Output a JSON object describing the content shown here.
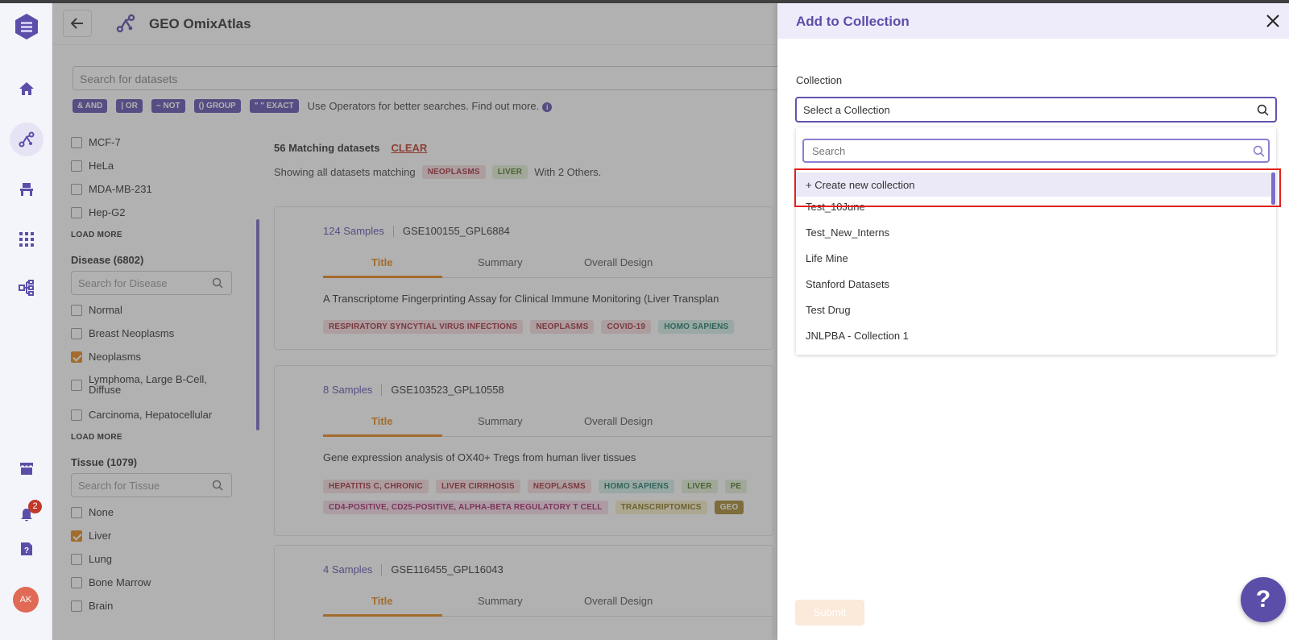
{
  "app": {
    "title": "GEO OmixAtlas",
    "notification_count": "2",
    "avatar_initials": "AK"
  },
  "search": {
    "placeholder": "Search for datasets",
    "operators": [
      "& AND",
      "| OR",
      "~ NOT",
      "() GROUP",
      "\" \" EXACT"
    ],
    "hint": "Use Operators for better searches. Find out more."
  },
  "filters": {
    "cell_lines": [
      {
        "label": "MCF-7",
        "checked": false
      },
      {
        "label": "HeLa",
        "checked": false
      },
      {
        "label": "MDA-MB-231",
        "checked": false
      },
      {
        "label": "Hep-G2",
        "checked": false
      }
    ],
    "load_more": "LOAD MORE",
    "disease": {
      "heading": "Disease (6802)",
      "search_placeholder": "Search for Disease",
      "items": [
        {
          "label": "Normal",
          "checked": false
        },
        {
          "label": "Breast Neoplasms",
          "checked": false
        },
        {
          "label": "Neoplasms",
          "checked": true
        },
        {
          "label": "Lymphoma, Large B-Cell, Diffuse",
          "checked": false
        },
        {
          "label": "Carcinoma, Hepatocellular",
          "checked": false
        }
      ]
    },
    "tissue": {
      "heading": "Tissue (1079)",
      "search_placeholder": "Search for Tissue",
      "items": [
        {
          "label": "None",
          "checked": false
        },
        {
          "label": "Liver",
          "checked": true
        },
        {
          "label": "Lung",
          "checked": false
        },
        {
          "label": "Bone Marrow",
          "checked": false
        },
        {
          "label": "Brain",
          "checked": false
        }
      ]
    }
  },
  "results": {
    "count_text": "56 Matching datasets",
    "clear_label": "CLEAR",
    "showing_prefix": "Showing all datasets matching",
    "active_tags": [
      "NEOPLASMS",
      "LIVER"
    ],
    "others_text": "With 2 Others.",
    "tab_labels": [
      "Title",
      "Summary",
      "Overall Design"
    ],
    "cards": [
      {
        "samples": "124 Samples",
        "gse": "GSE100155_GPL6884",
        "title": "A Transcriptome Fingerprinting Assay for Clinical Immune Monitoring (Liver Transplan",
        "tags": [
          [
            "RESPIRATORY SYNCYTIAL VIRUS INFECTIONS",
            "NEOPLASMS",
            "COVID-19",
            "HOMO SAPIENS"
          ]
        ]
      },
      {
        "samples": "8 Samples",
        "gse": "GSE103523_GPL10558",
        "title": "Gene expression analysis of OX40+ Tregs from human liver tissues",
        "tags": [
          [
            "HEPATITIS C, CHRONIC",
            "LIVER CIRRHOSIS",
            "NEOPLASMS",
            "HOMO SAPIENS",
            "LIVER",
            "PE"
          ],
          [
            "CD4-POSITIVE, CD25-POSITIVE, ALPHA-BETA REGULATORY T CELL",
            "TRANSCRIPTOMICS",
            "GEO"
          ]
        ]
      },
      {
        "samples": "4 Samples",
        "gse": "GSE116455_GPL16043",
        "title": "",
        "tags": []
      }
    ]
  },
  "panel": {
    "title": "Add to Collection",
    "collection_label": "Collection",
    "select_placeholder": "Select a Collection",
    "dropdown_search_placeholder": "Search",
    "create_label": "+ Create new collection",
    "options": [
      "Test_10June",
      "Test_New_Interns",
      "Life Mine",
      "Stanford Datasets",
      "Test Drug",
      "JNLPBA - Collection 1"
    ],
    "submit_label": "Submit"
  },
  "help_label": "?",
  "colors": {
    "accent": "#5b4ea9",
    "orange": "#e8891a",
    "highlight": "#e0211d"
  }
}
